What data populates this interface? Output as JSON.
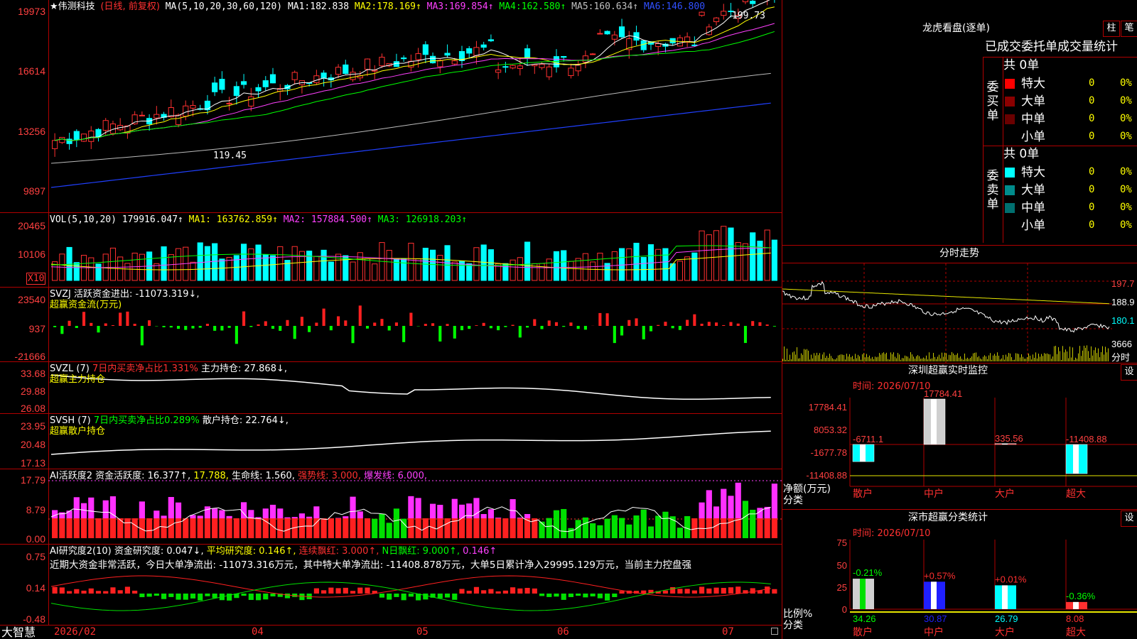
{
  "stock": {
    "name": "★伟测科技",
    "mode": "(日线, 前复权)"
  },
  "main_header": {
    "ma": "MA(5,10,20,30,60,120)",
    "items": [
      {
        "label": "MA1:",
        "value": "182.838",
        "color": "#ffffff"
      },
      {
        "label": "MA2:",
        "value": "178.169↑",
        "color": "#ffff00"
      },
      {
        "label": "MA3:",
        "value": "169.854↑",
        "color": "#ff40ff"
      },
      {
        "label": "MA4:",
        "value": "162.580↑",
        "color": "#00ff00"
      },
      {
        "label": "MA5:",
        "value": "160.634↑",
        "color": "#c0c0c0"
      },
      {
        "label": "MA6:",
        "value": "146.800",
        "color": "#3050ff"
      }
    ]
  },
  "main_y": [
    "19973",
    "16614",
    "13256",
    "9897"
  ],
  "high_mark": "199.73",
  "low_mark": "119.45",
  "vol_header": {
    "label": "VOL(5,10,20)",
    "vol": "179916.047↑",
    "ma1": "MA1: 163762.859↑",
    "ma2": "MA2: 157884.500↑",
    "ma3": "MA3: 126918.203↑"
  },
  "vol_y": [
    "20465",
    "10106"
  ],
  "vol_unit": "X10",
  "svzj_header": {
    "title": "SVZJ  活跃资金进出: -11073.319↓,",
    "sub": "超赢资金流(万元)"
  },
  "svzj_y": [
    "23540",
    "937",
    "-21666"
  ],
  "svzl_header": {
    "title": "SVZL (7)",
    "hint": "7日内买卖净占比1.331%",
    "main": "主力持仓: 27.868↓,",
    "sub": "超赢主力持仓"
  },
  "svzl_y": [
    "33.68",
    "29.88",
    "26.08"
  ],
  "svsh_header": {
    "title": "SVSH (7)",
    "hint": "7日内买卖净占比0.289%",
    "main": "散户持仓: 22.764↓,",
    "sub": "超赢散户持仓"
  },
  "svsh_y": [
    "23.95",
    "20.48",
    "17.13"
  ],
  "ai1_header": {
    "title": "AI活跃度2",
    "a": "资金活跃度: 16.377↑,",
    "b": "17.788,",
    "c": "生命线: 1.560,",
    "d": "强势线: 3.000,",
    "e": "爆发线: 6.000,"
  },
  "ai1_y": [
    "17.79",
    "8.79",
    "0.00"
  ],
  "ai2_header": {
    "title": "AI研究度2(10)",
    "a": "资金研究度: 0.047↓,",
    "b": "平均研究度: 0.146↑,",
    "c": "连续飘红: 3.000↑,",
    "d": "N日飘红: 9.000↑,",
    "e": "0.146↑"
  },
  "ai2_text": "近期大资金非常活跃，今日大单净流出: -11073.316万元，其中特大单净流出: -11408.878万元，大单5日累计净入29995.129万元，当前主力控盘强",
  "ai2_y": [
    "0.75",
    "0.14",
    "-0.48"
  ],
  "x_axis": {
    "brand": "大智慧",
    "labels": [
      "2026/02",
      "04",
      "05",
      "06",
      "07"
    ]
  },
  "dragon": {
    "title": "龙虎看盘(逐单)",
    "tabs": [
      "柱",
      "笔"
    ],
    "subtitle": "已成交委托单成交量统计",
    "buy_label": "委买单",
    "sell_label": "委卖单",
    "buy_total": "共 0单",
    "sell_total": "共 0单",
    "buy_rows": [
      {
        "name": "特大",
        "count": "0",
        "pct": "0%",
        "color": "#ff0000"
      },
      {
        "name": "大单",
        "count": "0",
        "pct": "0%",
        "color": "#8b0000"
      },
      {
        "name": "中单",
        "count": "0",
        "pct": "0%",
        "color": "#6a0000"
      },
      {
        "name": "小单",
        "count": "0",
        "pct": "0%",
        "color": ""
      }
    ],
    "sell_rows": [
      {
        "name": "特大",
        "count": "0",
        "pct": "0%",
        "color": "#00ffff"
      },
      {
        "name": "大单",
        "count": "0",
        "pct": "0%",
        "color": "#008b8b"
      },
      {
        "name": "中单",
        "count": "0",
        "pct": "0%",
        "color": "#006f6f"
      },
      {
        "name": "小单",
        "count": "0",
        "pct": "0%",
        "color": ""
      }
    ]
  },
  "intraday": {
    "title": "分时走势",
    "y": [
      "197.7",
      "188.9",
      "180.1"
    ],
    "vol": "3666",
    "vol_unit": "分时"
  },
  "monitor": {
    "title": "深圳超赢实时监控",
    "setting": "设",
    "time": "时间: 2026/07/10",
    "y": [
      "17784.41",
      "8053.32",
      "-1677.78",
      "-11408.88"
    ],
    "ylabel": "净额(万元)",
    "xlabel": "分类",
    "bars": [
      {
        "name": "散户",
        "value": "-6711.1"
      },
      {
        "name": "中户",
        "value": "17784.41"
      },
      {
        "name": "大户",
        "value": "335.56"
      },
      {
        "name": "超大",
        "value": "-11408.88"
      }
    ]
  },
  "classstat": {
    "title": "深市超赢分类统计",
    "setting": "设",
    "time": "时间: 2026/07/10",
    "y": [
      "75",
      "50",
      "25",
      "0"
    ],
    "ylabel": "比例%",
    "xlabel": "分类",
    "bars": [
      {
        "name": "散户",
        "pct": "34.26",
        "delta": "-0.21%"
      },
      {
        "name": "中户",
        "pct": "30.87",
        "delta": "+0.57%"
      },
      {
        "name": "大户",
        "pct": "26.79",
        "delta": "+0.01%"
      },
      {
        "name": "超大",
        "pct": "8.08",
        "delta": "-0.36%"
      }
    ]
  }
}
